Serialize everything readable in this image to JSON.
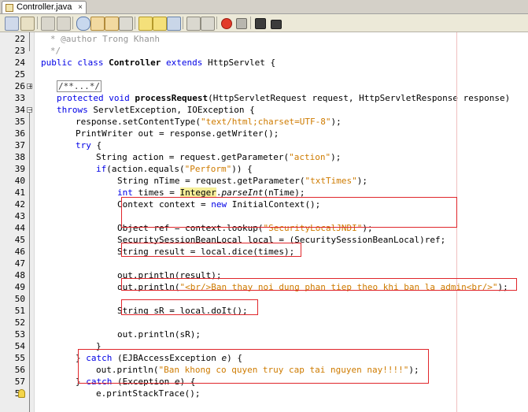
{
  "tab": {
    "title": "Controller.java",
    "close": "×",
    "icon": "java-file-icon"
  },
  "toolbar": {
    "icons": [
      "source-icon",
      "history-icon",
      "back-icon",
      "forward-icon",
      "find-icon",
      "find-prev-icon",
      "find-next-icon",
      "toggle-highlight-icon",
      "prev-bookmark-icon",
      "next-bookmark-icon",
      "toggle-bookmark-icon",
      "shift-left-icon",
      "shift-right-icon",
      "record-macro-icon",
      "stop-macro-icon",
      "comment-icon",
      "uncomment-icon"
    ]
  },
  "editor": {
    "lines": [
      {
        "num": "22",
        "text": "   * @author Trong Khanh"
      },
      {
        "num": "23",
        "text": "   */"
      },
      {
        "num": "24",
        "text": "public class Controller extends HttpServlet {"
      },
      {
        "num": "25",
        "text": ""
      },
      {
        "num": "26",
        "text": "/**...*/"
      },
      {
        "num": "33",
        "text": "protected void processRequest(HttpServletRequest request, HttpServletResponse response)"
      },
      {
        "num": "34",
        "text": "throws ServletException, IOException {"
      },
      {
        "num": "35",
        "text": "response.setContentType(\"text/html;charset=UTF-8\");"
      },
      {
        "num": "36",
        "text": "PrintWriter out = response.getWriter();"
      },
      {
        "num": "37",
        "text": "try {"
      },
      {
        "num": "38",
        "text": "String action = request.getParameter(\"action\");"
      },
      {
        "num": "39",
        "text": "if(action.equals(\"Perform\")) {"
      },
      {
        "num": "40",
        "text": "String nTime = request.getParameter(\"txtTimes\");"
      },
      {
        "num": "41",
        "text": "int times = Integer.parseInt(nTime);"
      },
      {
        "num": "42",
        "text": "Context context = new InitialContext();"
      },
      {
        "num": "43",
        "text": ""
      },
      {
        "num": "44",
        "text": "Object ref = context.lookup(\"SecurityLocalJNDI\");"
      },
      {
        "num": "45",
        "text": "SecuritySessionBeanLocal local = (SecuritySessionBeanLocal)ref;"
      },
      {
        "num": "46",
        "text": "String result = local.dice(times);"
      },
      {
        "num": "47",
        "text": ""
      },
      {
        "num": "48",
        "text": "out.println(result);"
      },
      {
        "num": "49",
        "text": "out.println(\"<br/>Ban thay noi dung phan tiep theo khi ban la admin<br/>\");"
      },
      {
        "num": "50",
        "text": ""
      },
      {
        "num": "51",
        "text": "String sR = local.doIt();"
      },
      {
        "num": "52",
        "text": ""
      },
      {
        "num": "53",
        "text": "out.println(sR);"
      },
      {
        "num": "54",
        "text": "}"
      },
      {
        "num": "55",
        "text": "} catch (EJBAccessException e) {"
      },
      {
        "num": "56",
        "text": "out.println(\"Ban khong co quyen truy cap tai nguyen nay!!!!\");"
      },
      {
        "num": "57",
        "text": "} catch (Exception e) {"
      },
      {
        "num": "58",
        "text": "e.printStackTrace();"
      }
    ]
  },
  "colors": {
    "keyword": "#0000e6",
    "string": "#ce7b00",
    "comment": "#969696",
    "annotation_box": "#e0262b",
    "highlight": "#f6ef9a"
  }
}
